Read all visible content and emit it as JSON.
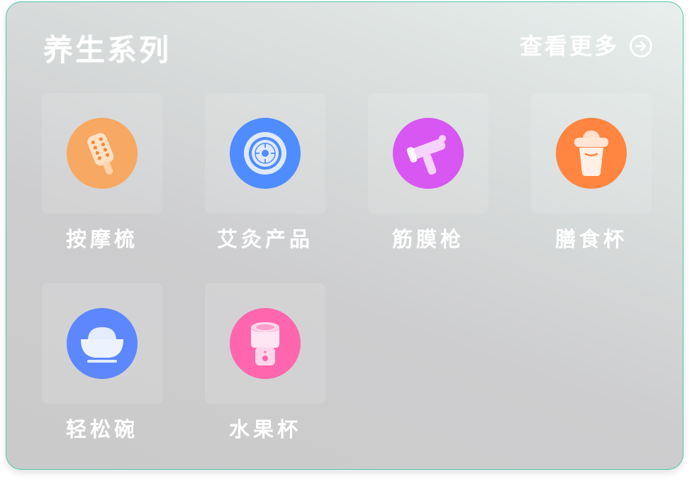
{
  "header": {
    "title": "养生系列",
    "more_label": "查看更多",
    "more_icon": "arrow-right-circle-icon"
  },
  "items": [
    {
      "label": "按摩梳",
      "icon": "massage-comb-icon",
      "color": "#f5a05a"
    },
    {
      "label": "艾灸产品",
      "icon": "moxibustion-device-icon",
      "color": "#4d8bff"
    },
    {
      "label": "筋膜枪",
      "icon": "massage-gun-icon",
      "color": "#d24ff0"
    },
    {
      "label": "膳食杯",
      "icon": "meal-cup-icon",
      "color": "#ff7a38"
    },
    {
      "label": "轻松碗",
      "icon": "bowl-icon",
      "color": "#5b86ff"
    },
    {
      "label": "水果杯",
      "icon": "fruit-cup-icon",
      "color": "#ff5fa8"
    }
  ]
}
